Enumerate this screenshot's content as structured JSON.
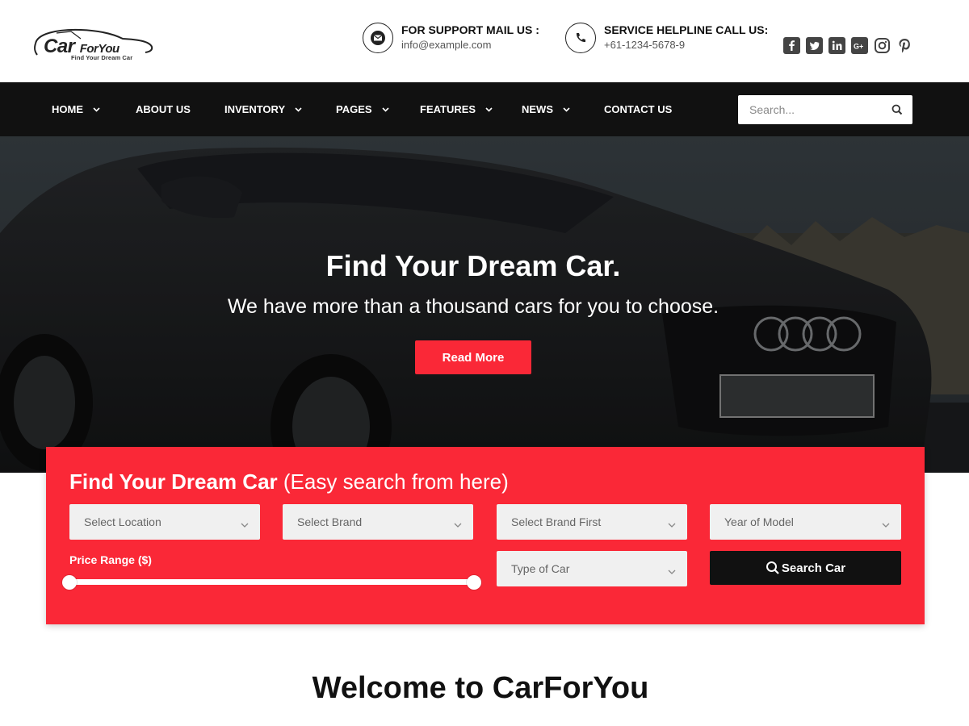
{
  "brand": {
    "logo_main": "Car",
    "logo_sub": "ForYou",
    "tagline": "Find Your Dream Car"
  },
  "header": {
    "support_label": "FOR SUPPORT MAIL US :",
    "support_value": "info@example.com",
    "helpline_label": "SERVICE HELPLINE CALL US:",
    "helpline_value": "+61-1234-5678-9",
    "social_icons": [
      "facebook-icon",
      "twitter-icon",
      "linkedin-icon",
      "google-plus-icon",
      "instagram-icon",
      "pinterest-icon"
    ]
  },
  "nav": {
    "items": [
      {
        "label": "HOME",
        "dropdown": true
      },
      {
        "label": "ABOUT US",
        "dropdown": false
      },
      {
        "label": "INVENTORY",
        "dropdown": true
      },
      {
        "label": "PAGES",
        "dropdown": true
      },
      {
        "label": "FEATURES",
        "dropdown": true
      },
      {
        "label": "NEWS",
        "dropdown": true
      },
      {
        "label": "CONTACT US",
        "dropdown": false
      }
    ],
    "search_placeholder": "Search..."
  },
  "hero": {
    "title": "Find Your Dream Car.",
    "subtitle": "We have more than a thousand cars for you to choose.",
    "cta": "Read More"
  },
  "search_panel": {
    "title_bold": "Find Your Dream Car",
    "title_light": "(Easy search from here)",
    "location": "Select Location",
    "brand": "Select Brand",
    "brand_first": "Select Brand First",
    "year": "Year of Model",
    "type": "Type of Car",
    "price_label": "Price Range ($)",
    "price_min_fraction": 0,
    "price_max_fraction": 1,
    "search_button": "Search Car"
  },
  "welcome": "Welcome to CarForYou",
  "colors": {
    "accent": "#fa2837",
    "dark": "#111111"
  }
}
